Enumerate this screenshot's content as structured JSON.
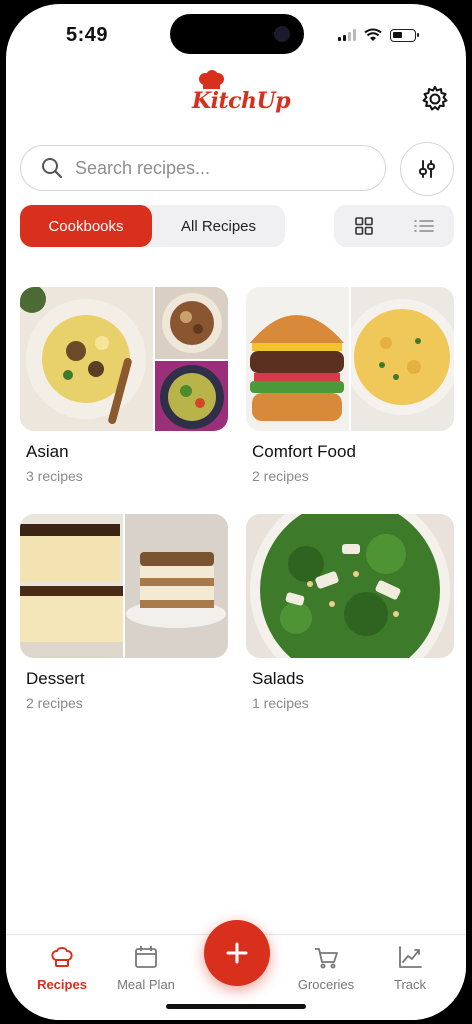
{
  "status_bar": {
    "time": "5:49"
  },
  "header": {
    "logo_text": "KitchUp"
  },
  "search": {
    "placeholder": "Search recipes..."
  },
  "segmented": {
    "cookbooks_label": "Cookbooks",
    "all_recipes_label": "All Recipes",
    "active": "Cookbooks"
  },
  "view_toggle": {
    "active": "grid",
    "options": [
      "grid-icon",
      "list-icon"
    ]
  },
  "cookbooks": [
    {
      "name": "Asian",
      "count": "3 recipes"
    },
    {
      "name": "Comfort Food",
      "count": "2 recipes"
    },
    {
      "name": "Dessert",
      "count": "2 recipes"
    },
    {
      "name": "Salads",
      "count": "1 recipes"
    }
  ],
  "tabbar": {
    "items": [
      {
        "label": "Recipes",
        "icon": "chef-hat-icon",
        "active": true
      },
      {
        "label": "Meal Plan",
        "icon": "calendar-icon",
        "active": false
      },
      {
        "label": "Groceries",
        "icon": "cart-icon",
        "active": false
      },
      {
        "label": "Track",
        "icon": "chart-icon",
        "active": false
      }
    ],
    "fab_icon": "plus-icon"
  },
  "colors": {
    "accent": "#d8301c",
    "text": "#111111",
    "muted": "#8a8a8a",
    "segment_bg": "#f0f0f2"
  }
}
